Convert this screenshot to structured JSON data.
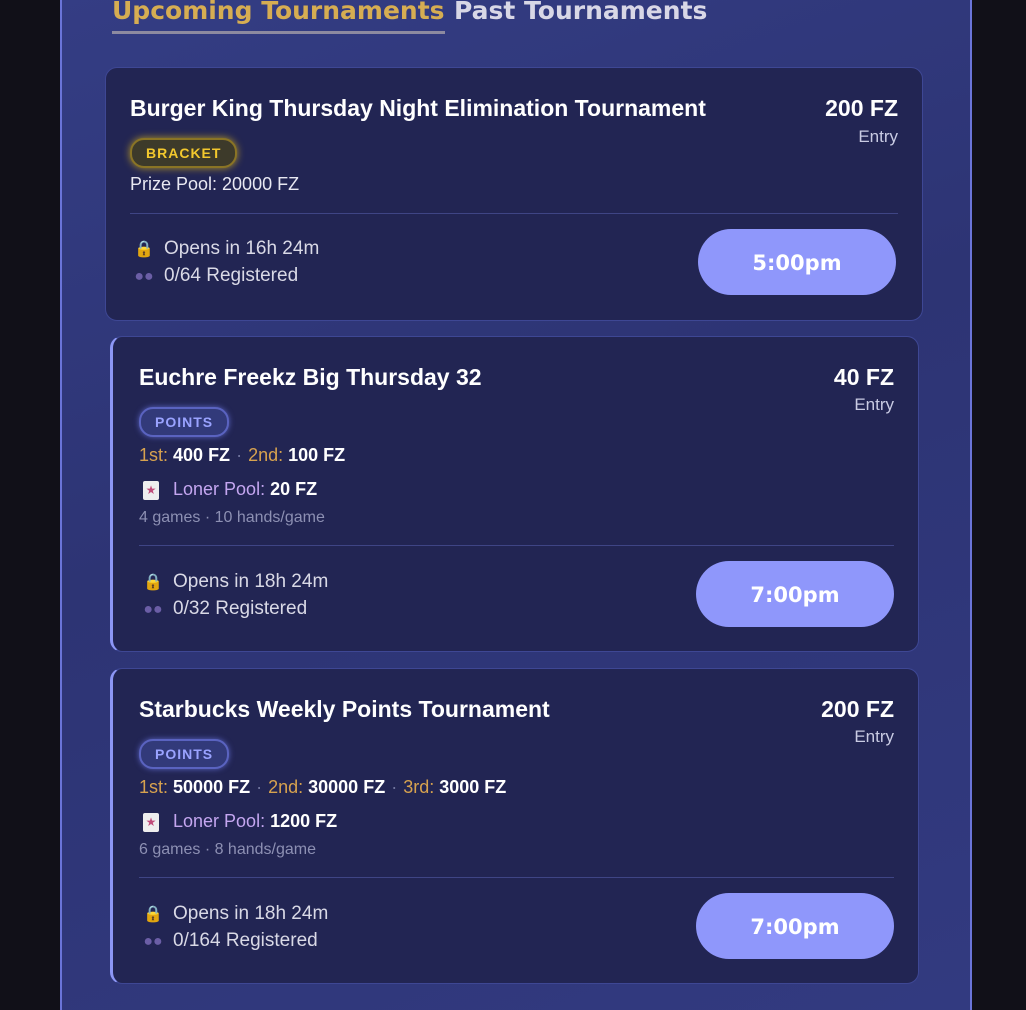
{
  "tabs": {
    "upcoming": "Upcoming Tournaments",
    "past": "Past Tournaments"
  },
  "cards": [
    {
      "title": "Burger King Thursday Night Elimination Tournament",
      "entry_amount": "200 FZ",
      "entry_label": "Entry",
      "badge": "BRACKET",
      "prize_pool": "Prize Pool: 20000 FZ",
      "opens": "Opens in 16h 24m",
      "registered": "0/64 Registered",
      "time": "5:00pm"
    },
    {
      "title": "Euchre Freekz Big Thursday 32",
      "entry_amount": "40 FZ",
      "entry_label": "Entry",
      "badge": "POINTS",
      "prizes": [
        {
          "place": "1st:",
          "amount": "400 FZ"
        },
        {
          "place": "2nd:",
          "amount": "100 FZ"
        }
      ],
      "loner_label": "Loner Pool:",
      "loner_amount": "20 FZ",
      "games": "4 games · 10 hands/game",
      "opens": "Opens in 18h 24m",
      "registered": "0/32 Registered",
      "time": "7:00pm"
    },
    {
      "title": "Starbucks Weekly Points Tournament",
      "entry_amount": "200 FZ",
      "entry_label": "Entry",
      "badge": "POINTS",
      "prizes": [
        {
          "place": "1st:",
          "amount": "50000 FZ"
        },
        {
          "place": "2nd:",
          "amount": "30000 FZ"
        },
        {
          "place": "3rd:",
          "amount": "3000 FZ"
        }
      ],
      "loner_label": "Loner Pool:",
      "loner_amount": "1200 FZ",
      "games": "6 games · 8 hands/game",
      "opens": "Opens in 18h 24m",
      "registered": "0/164 Registered",
      "time": "7:00pm"
    }
  ],
  "icons": {
    "lock": "lock-icon",
    "users": "users-icon",
    "joker": "joker-card-icon"
  },
  "colors": {
    "accent": "#8f97fb",
    "gold": "#d7a24f",
    "bracket": "#f3c82d",
    "points": "#9aa3ff"
  }
}
